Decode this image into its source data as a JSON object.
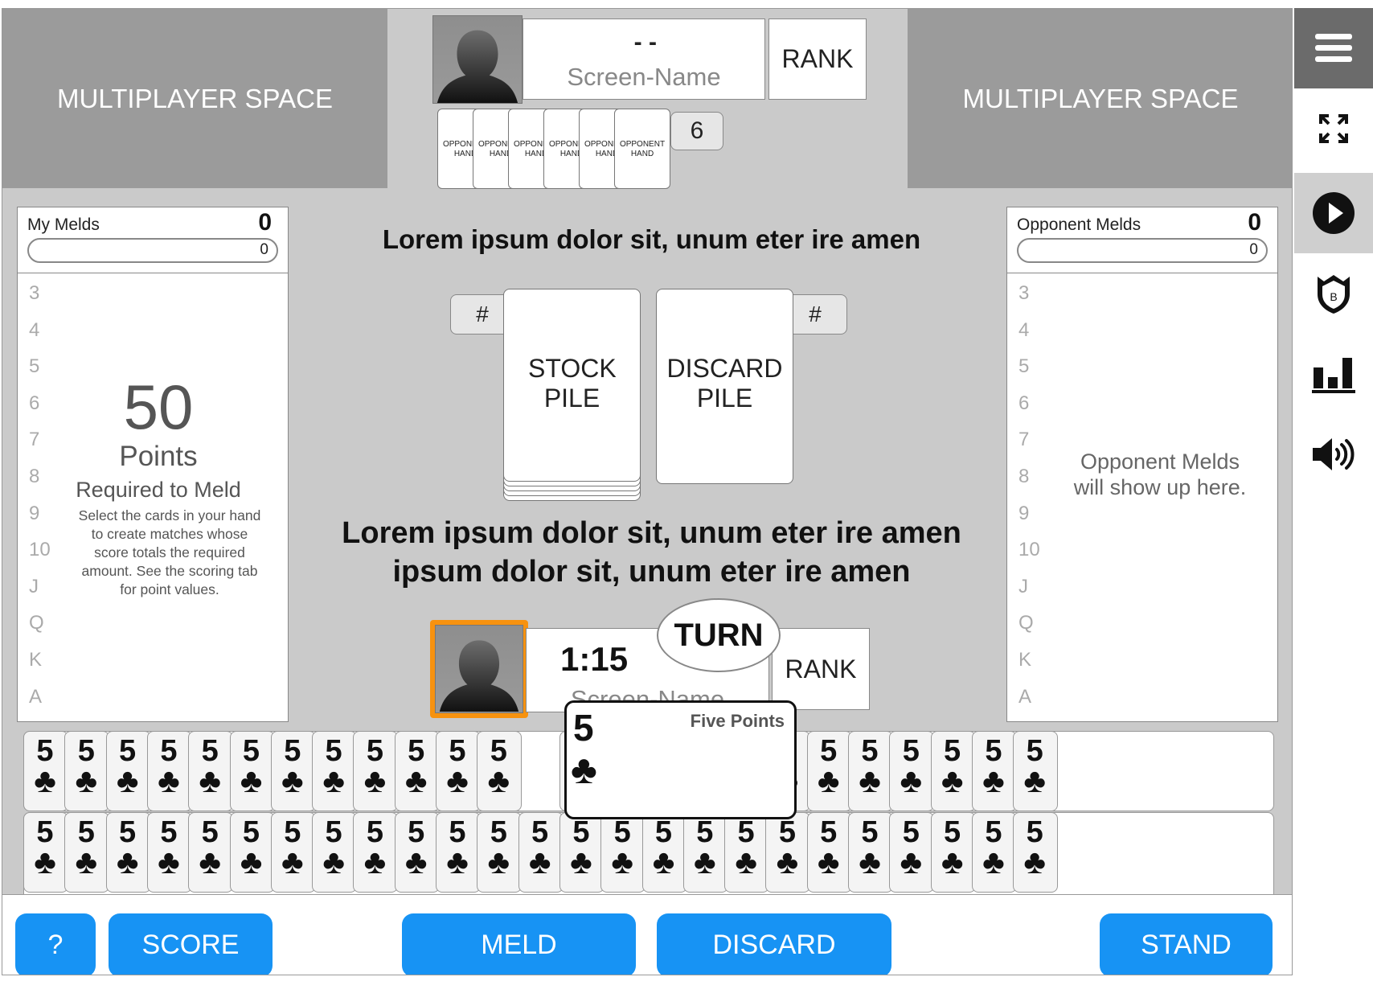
{
  "multiplayer": {
    "left_label": "MULTIPLAYER SPACE",
    "right_label": "MULTIPLAYER SPACE"
  },
  "opponent": {
    "score_text": "- -",
    "screen_name": "Screen-Name",
    "rank_label": "RANK",
    "hand_card_label": "OPPONENT HAND",
    "hand_count": "6"
  },
  "my_melds": {
    "title": "My Melds",
    "score": "0",
    "bar_value": "0",
    "ranks": [
      "3",
      "4",
      "5",
      "6",
      "7",
      "8",
      "9",
      "10",
      "J",
      "Q",
      "K",
      "A"
    ],
    "points_value": "50",
    "points_label": "Points",
    "required_label": "Required to Meld",
    "instructions": "Select the cards in your hand to create matches whose score totals the required amount. See the scoring tab for point values."
  },
  "opponent_melds": {
    "title": "Opponent Melds",
    "score": "0",
    "bar_value": "0",
    "ranks": [
      "3",
      "4",
      "5",
      "6",
      "7",
      "8",
      "9",
      "10",
      "J",
      "Q",
      "K",
      "A"
    ],
    "placeholder": "Opponent Melds will show up here."
  },
  "center": {
    "headline_top": "Lorem ipsum dolor sit, unum eter ire amen",
    "headline_bottom": "Lorem ipsum dolor sit, unum eter ire amen ipsum dolor sit, unum eter ire amen",
    "stock_label": "STOCK PILE",
    "stock_count": "#",
    "discard_label": "DISCARD PILE",
    "discard_count": "#"
  },
  "player": {
    "timer": "1:15",
    "screen_name": "Screen-Name",
    "rank_label": "RANK",
    "turn_label": "TURN",
    "highlight_color": "#f7920f"
  },
  "hand": {
    "card_rank": "5",
    "card_suit": "♣",
    "selected_rank": "5",
    "selected_suit": "♣",
    "selected_tooltip": "Five Points",
    "row1_count": 24,
    "row2_count": 25
  },
  "buttons": {
    "help": "?",
    "score": "SCORE",
    "meld": "MELD",
    "discard": "DISCARD",
    "stand": "STAND",
    "color": "#1793f4"
  },
  "sidebar": {
    "icons": [
      "menu-icon",
      "fullscreen-icon",
      "play-icon",
      "badge-icon",
      "stats-icon",
      "volume-icon"
    ],
    "badge_letter": "B"
  }
}
